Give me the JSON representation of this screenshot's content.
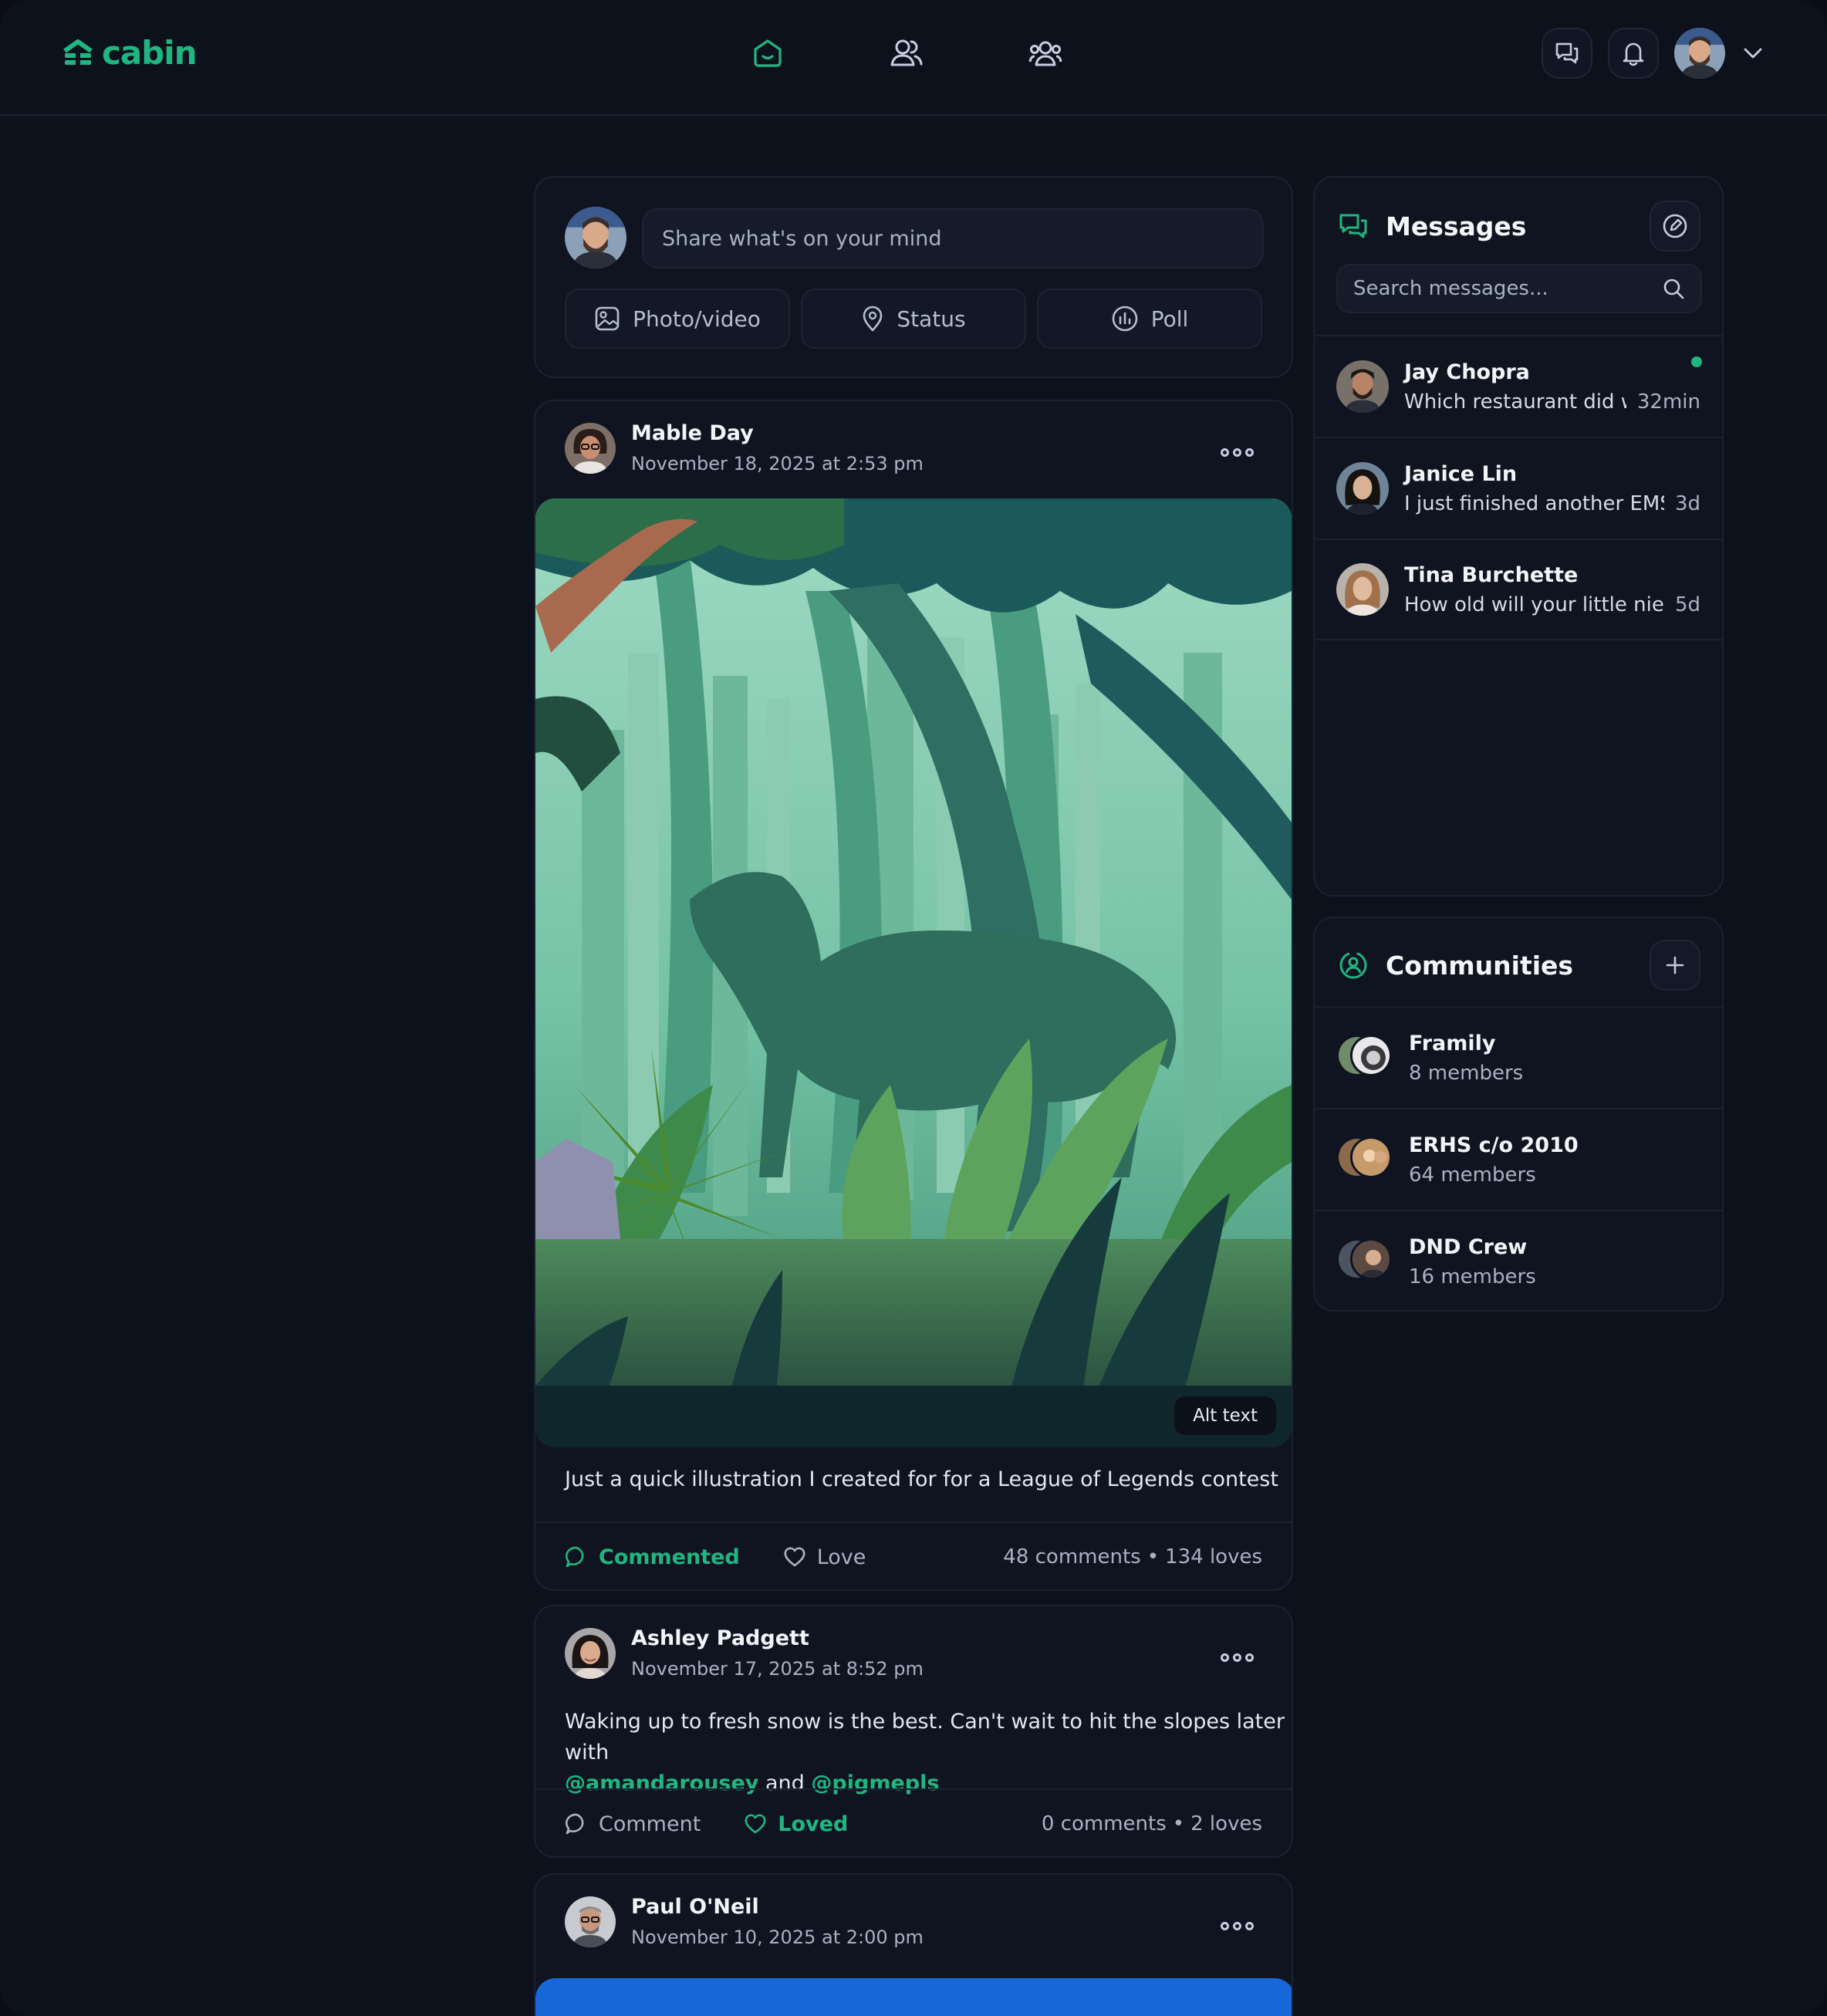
{
  "brand": {
    "name": "cabin",
    "accent": "#1fb681"
  },
  "nav": {
    "icons": [
      "home-icon",
      "friends-icon",
      "communities-icon"
    ],
    "active": "home-icon"
  },
  "topbar": {
    "chat_icon": "chat-icon",
    "bell_icon": "bell-icon",
    "menu_icon": "chevron-down-icon"
  },
  "composer": {
    "placeholder": "Share what's on your mind",
    "buttons": [
      {
        "label": "Photo/video",
        "icon": "image-icon"
      },
      {
        "label": "Status",
        "icon": "location-pin-icon"
      },
      {
        "label": "Poll",
        "icon": "poll-icon"
      }
    ]
  },
  "posts": [
    {
      "author": "Mable Day",
      "date": "November 18, 2025 at 2:53 pm",
      "image_alt_badge": "Alt text",
      "text": "Just a quick illustration I created for for a League of Legends contest",
      "action_comment": "Commented",
      "action_love": "Love",
      "comments": "48 comments",
      "loves": "134 loves"
    },
    {
      "author": "Ashley Padgett",
      "date": "November 17, 2025 at 8:52 pm",
      "text_before": "Waking up to fresh snow is the best. Can't wait to hit the slopes later with",
      "mention1": "@amandarousey",
      "text_and": "and",
      "mention2": "@pigmepls",
      "action_comment": "Comment",
      "action_love": "Loved",
      "comments": "0 comments",
      "loves": "2 loves"
    },
    {
      "author": "Paul O'Neil",
      "date": "November 10, 2025 at 2:00 pm"
    }
  ],
  "stat_separator": "•",
  "messages": {
    "title": "Messages",
    "search_placeholder": "Search messages...",
    "items": [
      {
        "name": "Jay Chopra",
        "preview": "Which restaurant did w...",
        "time": "32min",
        "online": true
      },
      {
        "name": "Janice Lin",
        "preview": "I just finished another EMS...",
        "time": "3d"
      },
      {
        "name": "Tina Burchette",
        "preview": "How old will your little niece...",
        "time": "5d"
      }
    ]
  },
  "communities": {
    "title": "Communities",
    "items": [
      {
        "name": "Framily",
        "members": "8 members"
      },
      {
        "name": "ERHS c/o 2010",
        "members": "64 members"
      },
      {
        "name": "DND Crew",
        "members": "16 members"
      }
    ]
  }
}
